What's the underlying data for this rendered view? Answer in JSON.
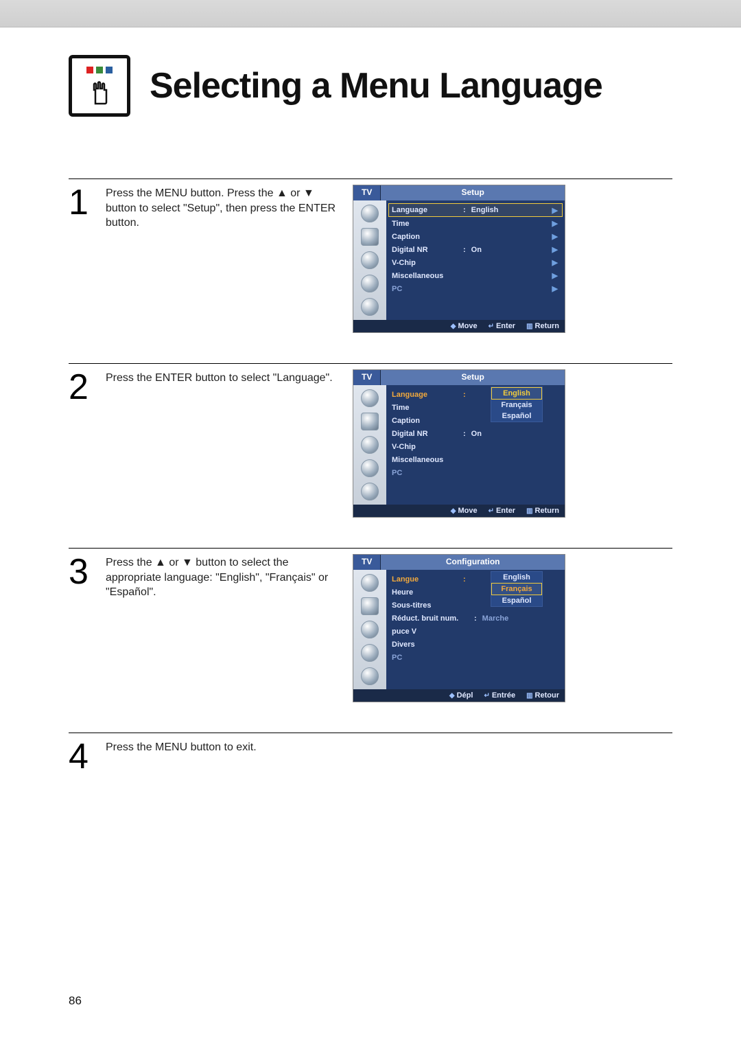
{
  "page_title": "Selecting a Menu Language",
  "page_number": "86",
  "steps": {
    "s1": {
      "num": "1",
      "text": "Press the MENU button. Press the ▲ or ▼ button to select \"Setup\", then press the ENTER button."
    },
    "s2": {
      "num": "2",
      "text": "Press the ENTER button to select \"Language\"."
    },
    "s3": {
      "num": "3",
      "text": "Press the ▲ or ▼ button to select the appropriate language: \"English\", \"Français\" or \"Español\"."
    },
    "s4": {
      "num": "4",
      "text": "Press the MENU button to exit."
    }
  },
  "menus": {
    "m1": {
      "tab": "TV",
      "title": "Setup",
      "rows": {
        "language": {
          "label": "Language",
          "value": "English"
        },
        "time": {
          "label": "Time"
        },
        "caption": {
          "label": "Caption"
        },
        "digital_nr": {
          "label": "Digital NR",
          "value": "On"
        },
        "vchip": {
          "label": "V-Chip"
        },
        "misc": {
          "label": "Miscellaneous"
        },
        "pc": {
          "label": "PC"
        }
      },
      "footer": {
        "move": "Move",
        "enter": "Enter",
        "return": "Return"
      }
    },
    "m2": {
      "tab": "TV",
      "title": "Setup",
      "rows": {
        "language": {
          "label": "Language"
        },
        "time": {
          "label": "Time"
        },
        "caption": {
          "label": "Caption"
        },
        "digital_nr": {
          "label": "Digital NR",
          "value": "On"
        },
        "vchip": {
          "label": "V-Chip"
        },
        "misc": {
          "label": "Miscellaneous"
        },
        "pc": {
          "label": "PC"
        }
      },
      "dropdown": {
        "o1": "English",
        "o2": "Français",
        "o3": "Español"
      },
      "footer": {
        "move": "Move",
        "enter": "Enter",
        "return": "Return"
      }
    },
    "m3": {
      "tab": "TV",
      "title": "Configuration",
      "rows": {
        "langue": {
          "label": "Langue"
        },
        "heure": {
          "label": "Heure"
        },
        "sous": {
          "label": "Sous-titres"
        },
        "reduct": {
          "label": "Réduct. bruit num.",
          "value": "Marche"
        },
        "puce": {
          "label": "puce V"
        },
        "divers": {
          "label": "Divers"
        },
        "pc": {
          "label": "PC"
        }
      },
      "dropdown": {
        "o1": "English",
        "o2": "Français",
        "o3": "Español"
      },
      "footer": {
        "move": "Dépl",
        "enter": "Entrée",
        "return": "Retour"
      }
    }
  }
}
